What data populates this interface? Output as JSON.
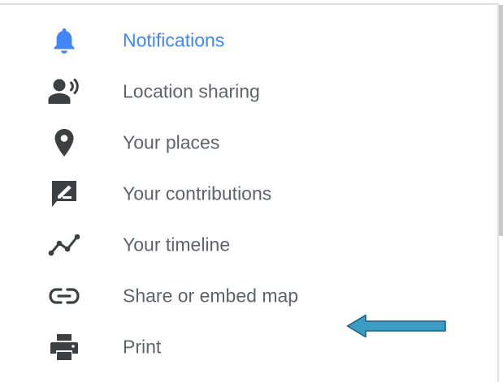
{
  "menu": {
    "items": [
      {
        "label": "Notifications",
        "icon": "bell-icon",
        "active": true
      },
      {
        "label": "Location sharing",
        "icon": "location-sharing-icon",
        "active": false
      },
      {
        "label": "Your places",
        "icon": "place-pin-icon",
        "active": false
      },
      {
        "label": "Your contributions",
        "icon": "contributions-icon",
        "active": false
      },
      {
        "label": "Your timeline",
        "icon": "timeline-icon",
        "active": false
      },
      {
        "label": "Share or embed map",
        "icon": "link-icon",
        "active": false
      },
      {
        "label": "Print",
        "icon": "print-icon",
        "active": false
      }
    ]
  },
  "annotation": {
    "icon": "left-arrow-annotation",
    "fill_color": "#3b9cc4",
    "stroke_color": "#1f5f7a"
  },
  "colors": {
    "active": "#4285f4",
    "text": "#5f6368",
    "icon": "#3c4043"
  }
}
